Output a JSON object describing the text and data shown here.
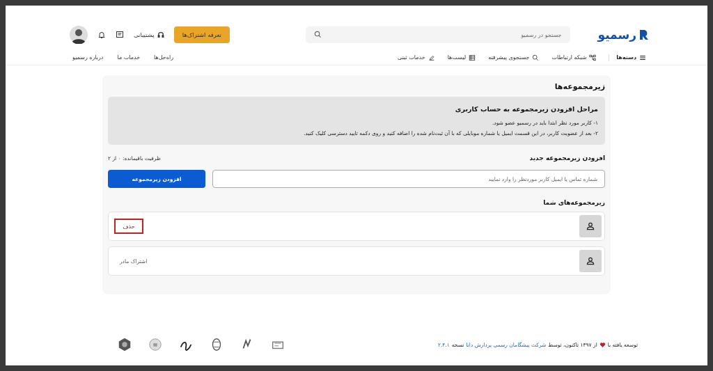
{
  "header": {
    "logo": "رسمیو",
    "search": {
      "placeholder": "جستجو در رسمیو"
    },
    "categories": "دسته‌ها",
    "nav": [
      {
        "label": "شبکه ارتباطات",
        "kind": "network"
      },
      {
        "label": "جستجوی پیشرفته",
        "kind": "search"
      },
      {
        "label": "لیست‌ها",
        "kind": "list"
      },
      {
        "label": "خدمات ثبتی",
        "kind": "pen"
      }
    ],
    "plan_button": "تعرفه اشتراک‌ها",
    "support": "پشتیبانی",
    "links": [
      "راه‌حل‌ها",
      "خدمات ما",
      "درباره رسمیو"
    ]
  },
  "main": {
    "title": "زیرمجموعه‌ها",
    "info": {
      "title": "مراحل افزودن زیرمجموعه به حساب کاربری",
      "steps": [
        "۱- کاربر مورد نظر ابتدا باید در رسمیو عضو شود.",
        "۲- بعد از عضویت کاربر، در این قسمت ایمیل یا شماره موبایلی که با آن ثبت‌نام شده را اضافه کنید و روی دکمه تایید دسترسی کلیک کنید."
      ]
    },
    "add": {
      "title": "افزودن زیرمجموعه جدید",
      "capacity": "ظرفیت باقیمانده: ۰ از ۲",
      "placeholder": "شماره تماس یا ایمیل کاربر موردنظر را وارد نمایید",
      "button": "افزودن زیرمجموعه"
    },
    "list_title": "زیرمجموعه‌های شما",
    "members": [
      {
        "kind": "child",
        "action": "حذف"
      },
      {
        "kind": "parent",
        "note": "اشتراک مادر"
      }
    ]
  },
  "footer": {
    "prefix": "توسعه یافته با",
    "middle": "از ۱۳۹۷ تاکنون، توسط",
    "company": "شرکت پیشگامان رسمی پردازش دانا",
    "version_label": "نسخه",
    "version": "۲.۴.۱"
  }
}
